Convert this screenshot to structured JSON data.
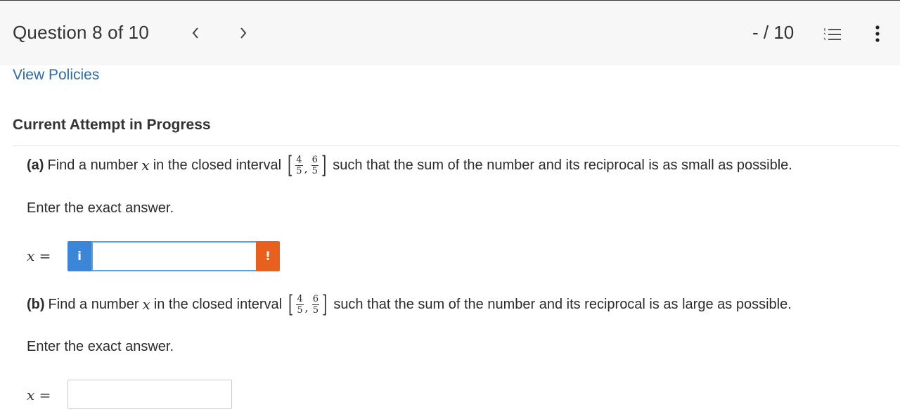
{
  "header": {
    "question_label": "Question 8 of 10",
    "score": "- / 10",
    "prev_icon": "chevron-left-icon",
    "next_icon": "chevron-right-icon",
    "list_icon": "numbered-list-icon",
    "more_icon": "more-vertical-icon"
  },
  "links": {
    "view_policies": "View Policies"
  },
  "attempt": {
    "title": "Current Attempt in Progress"
  },
  "parts": [
    {
      "label": "(a)",
      "text_before": "Find a number",
      "variable": "x",
      "text_middle": "in the closed interval",
      "interval": {
        "left_bracket": "[",
        "a_num": "4",
        "a_den": "5",
        "separator": ",",
        "b_num": "6",
        "b_den": "5",
        "right_bracket": "]"
      },
      "text_after": "such that the sum of the number and its reciprocal is as small as possible.",
      "instruction": "Enter the exact answer.",
      "answer_label_var": "x",
      "answer_label_eq": " =",
      "answer_value": "",
      "info_glyph": "i",
      "warn_glyph": "!"
    },
    {
      "label": "(b)",
      "text_before": "Find a number",
      "variable": "x",
      "text_middle": "in the closed interval",
      "interval": {
        "left_bracket": "[",
        "a_num": "4",
        "a_den": "5",
        "separator": ",",
        "b_num": "6",
        "b_den": "5",
        "right_bracket": "]"
      },
      "text_after": "such that the sum of the number and its reciprocal is as large as possible.",
      "instruction": "Enter the exact answer.",
      "answer_label_var": "x",
      "answer_label_eq": " =",
      "answer_value": ""
    }
  ],
  "colors": {
    "link": "#2d6aa6",
    "info_button": "#3b86d6",
    "warning_button": "#e8601e",
    "header_bg": "#f7f7f7",
    "input_focus_border": "#5d9fe0"
  }
}
